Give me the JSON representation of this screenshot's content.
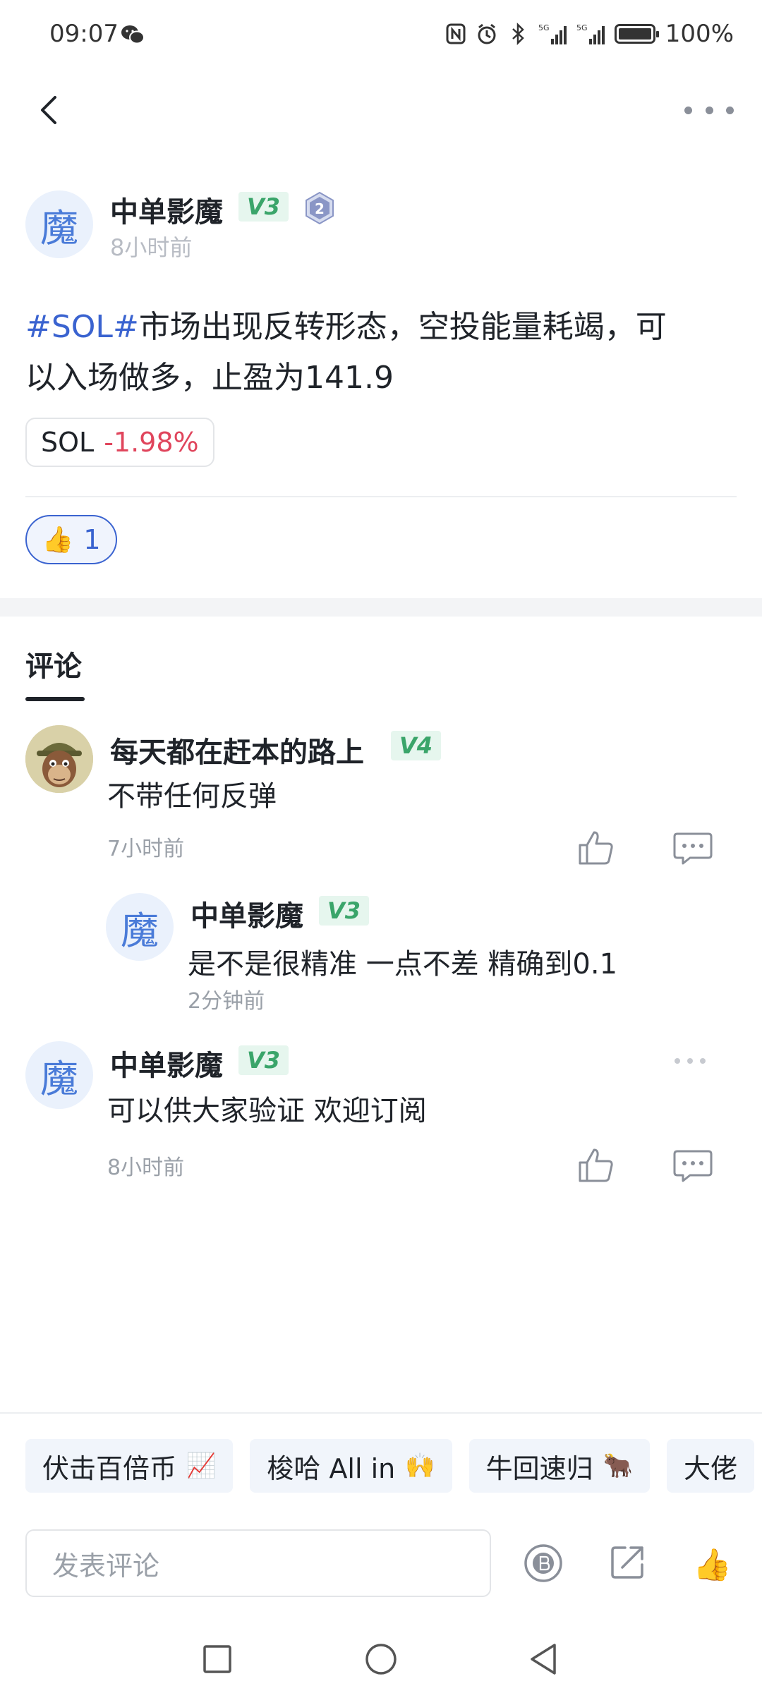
{
  "status_bar": {
    "time": "09:07",
    "battery": "100%",
    "signal_1": "5G",
    "signal_2": "5G"
  },
  "post": {
    "avatar_char": "魔",
    "author": "中单影魔",
    "vip": "V3",
    "level": "2",
    "time": "8小时前",
    "hashtag": "#SOL#",
    "text_line1": "市场出现反转形态，空投能量耗竭，可",
    "text_line2": "以入场做多，止盈为141.9",
    "coin": {
      "symbol": "SOL",
      "change": "-1.98%"
    },
    "likes": "1"
  },
  "comments_tab": "评论",
  "comments": [
    {
      "author": "每天都在赶本的路上",
      "vip": "V4",
      "text": "不带任何反弹",
      "time": "7小时前"
    },
    {
      "avatar_char": "魔",
      "author": "中单影魔",
      "vip": "V3",
      "text": "是不是很精准 一点不差 精确到0.1",
      "time": "2分钟前"
    },
    {
      "avatar_char": "魔",
      "author": "中单影魔",
      "vip": "V3",
      "text": "可以供大家验证 欢迎订阅",
      "time": "8小时前"
    }
  ],
  "quick_replies": [
    {
      "label": "伏击百倍币",
      "emoji": "📈"
    },
    {
      "label": "梭哈 All in",
      "emoji": "🙌"
    },
    {
      "label": "牛回速归",
      "emoji": "🐂"
    },
    {
      "label": "大佬",
      "emoji": ""
    }
  ],
  "comment_input": {
    "placeholder": "发表评论"
  },
  "colors": {
    "accent": "#3a63d0",
    "negative": "#e0455c",
    "vip_badge_bg": "#e6f6ee",
    "vip_badge_text": "#3aa56a"
  }
}
